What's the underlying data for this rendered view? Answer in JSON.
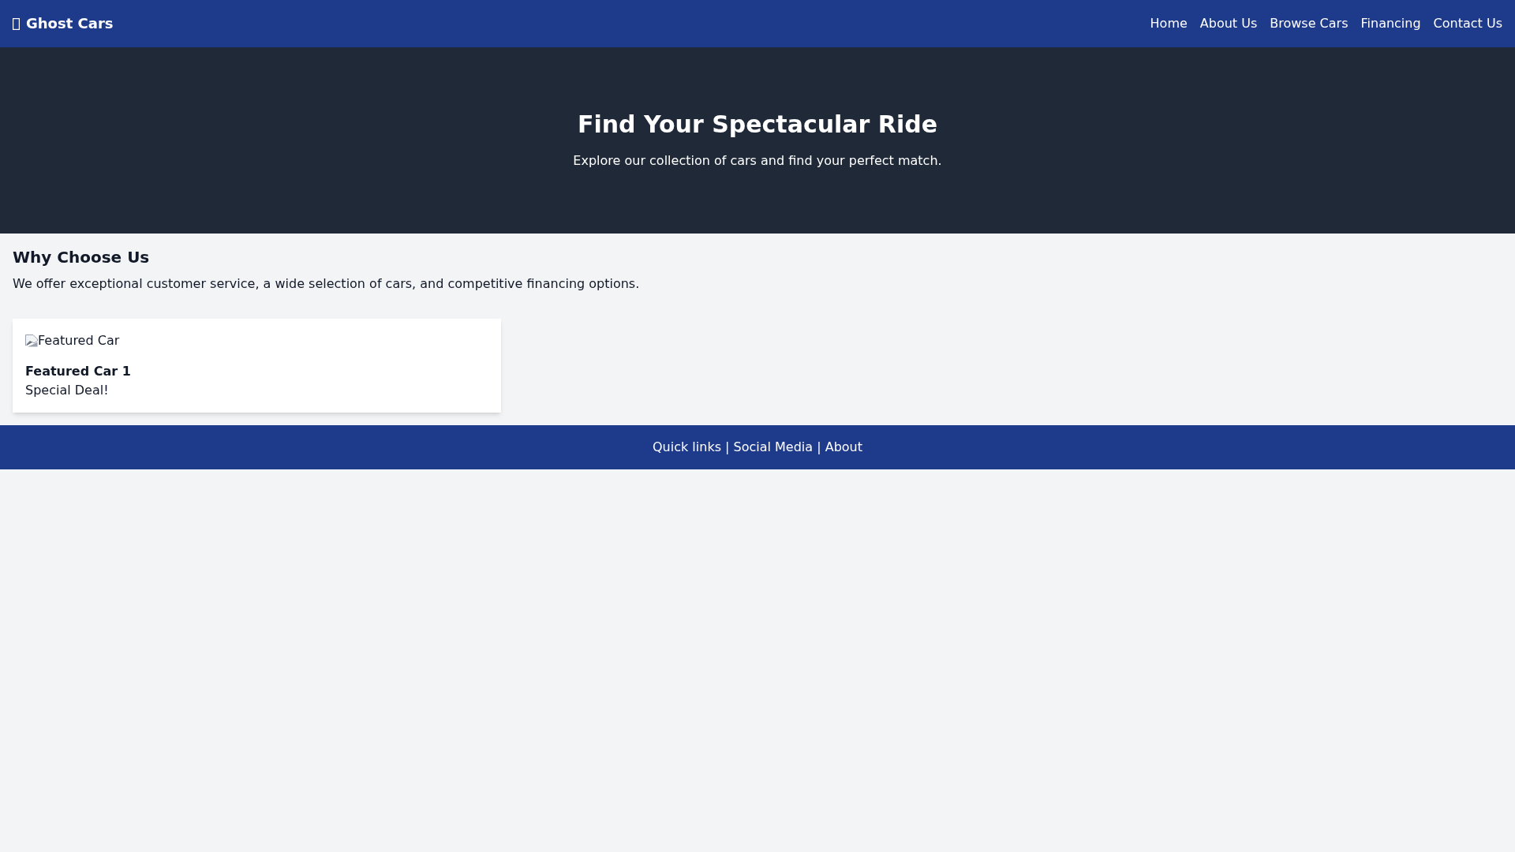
{
  "header": {
    "logo": "Ghost Cars",
    "nav": [
      {
        "label": "Home"
      },
      {
        "label": "About Us"
      },
      {
        "label": "Browse Cars"
      },
      {
        "label": "Financing"
      },
      {
        "label": "Contact Us"
      }
    ]
  },
  "hero": {
    "title": "Find Your Spectacular Ride",
    "subtitle": "Explore our collection of cars and find your perfect match."
  },
  "why_choose_us": {
    "heading": "Why Choose Us",
    "text": "We offer exceptional customer service, a wide selection of cars, and competitive financing options."
  },
  "featured_cars": [
    {
      "image_alt": "Featured Car",
      "title": "Featured Car 1",
      "note": "Special Deal!"
    }
  ],
  "footer": {
    "text": "Quick links | Social Media | About"
  }
}
